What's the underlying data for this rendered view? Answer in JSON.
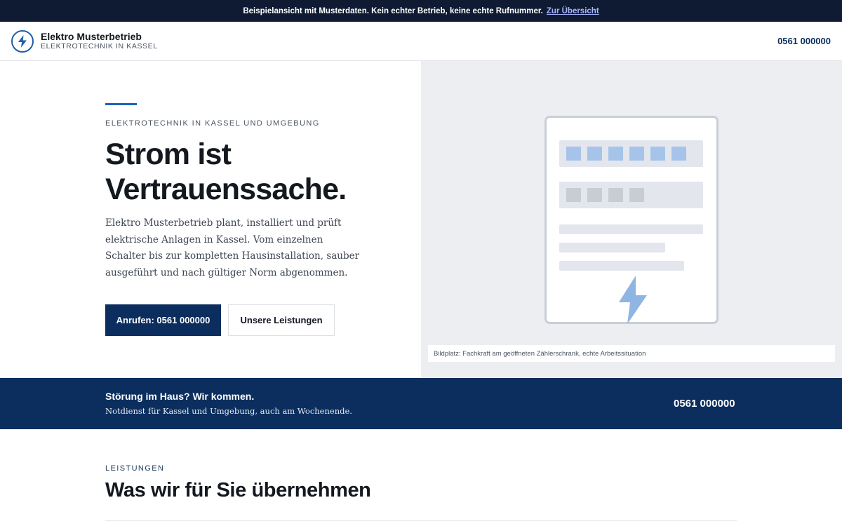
{
  "demo_banner": {
    "text": "Beispielansicht mit Musterdaten. Kein echter Betrieb, keine echte Rufnummer.",
    "link_label": "Zur Übersicht"
  },
  "header": {
    "brand_name": "Elektro Musterbetrieb",
    "brand_tagline": "ELEKTROTECHNIK IN KASSEL",
    "phone": "0561 000000",
    "logo_icon": "lightning-bolt-icon"
  },
  "hero": {
    "eyebrow": "ELEKTROTECHNIK IN KASSEL UND UMGEBUNG",
    "title_line1": "Strom ist",
    "title_line2": "Vertrauenssache.",
    "text": "Elektro Musterbetrieb plant, installiert und prüft elektrische Anlagen in Kassel. Vom einzelnen Schalter bis zur kompletten Hausinstallation, sauber ausgeführt und nach gültiger Norm abgenommen.",
    "primary_button": "Anrufen: 0561 000000",
    "secondary_button": "Unsere Leistungen",
    "image_caption": "Bildplatz: Fachkraft am geöffneten Zählerschrank, echte Arbeitssituation"
  },
  "emergency": {
    "title": "Störung im Haus? Wir kommen.",
    "subtitle": "Notdienst für Kassel und Umgebung, auch am Wochenende.",
    "phone": "0561 000000"
  },
  "services": {
    "eyebrow": "LEISTUNGEN",
    "title": "Was wir für Sie übernehmen"
  },
  "colors": {
    "navy": "#0b2e5e",
    "banner": "#0f1a33",
    "accent_blue": "#1f63b5",
    "hero_panel": "#eceef2"
  }
}
